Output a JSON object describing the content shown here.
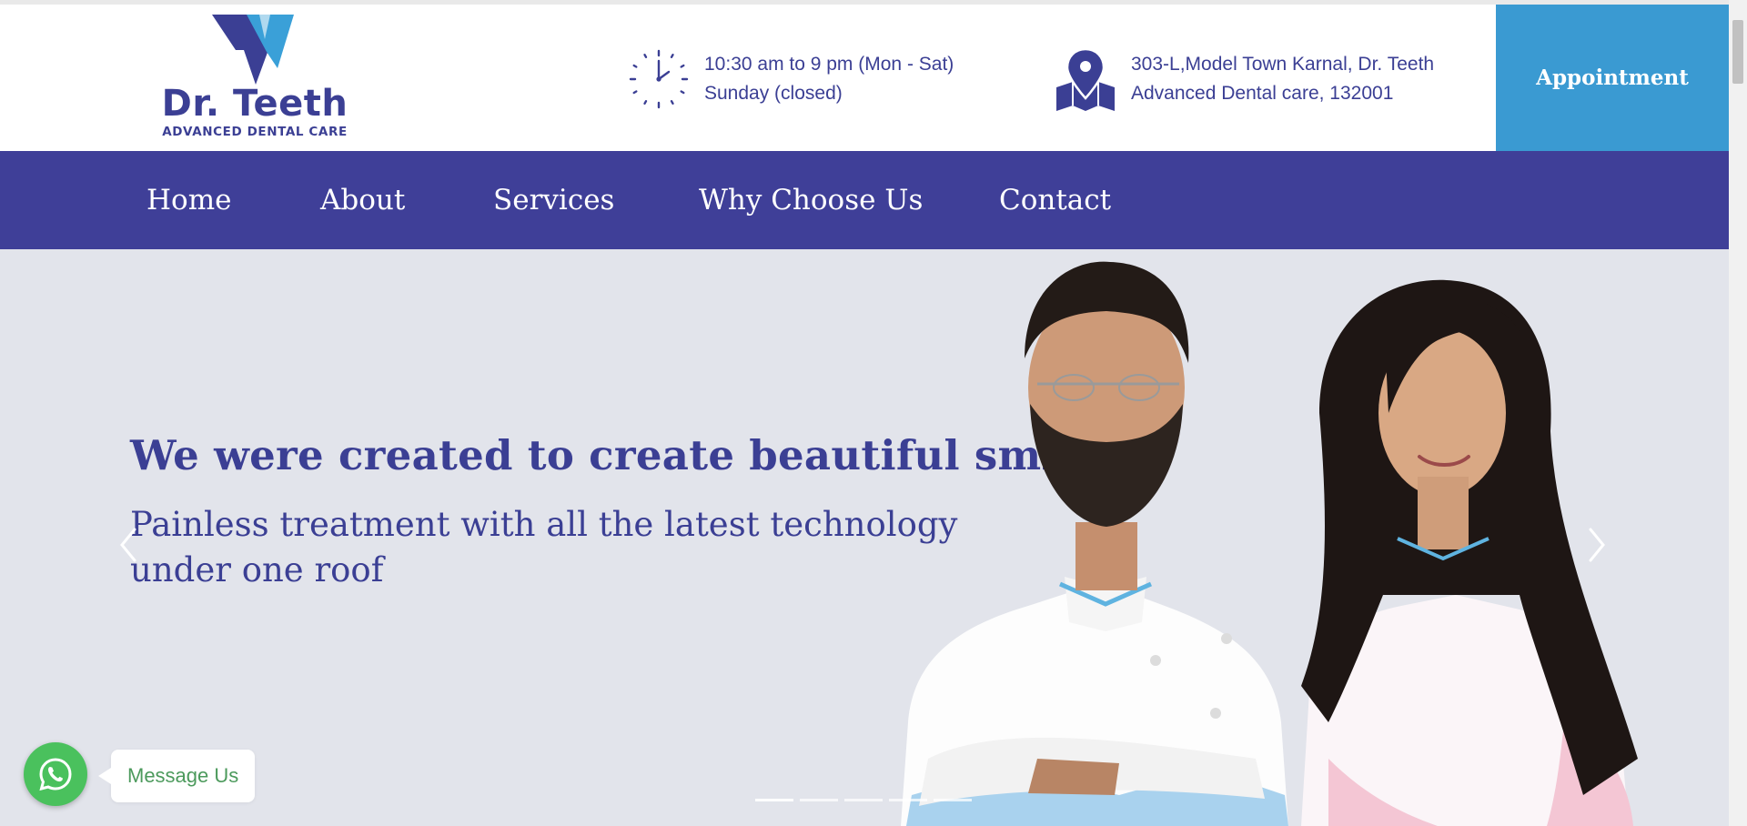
{
  "brand": {
    "name": "Dr. Teeth",
    "tagline": "ADVANCED DENTAL CARE"
  },
  "header": {
    "hours_line1": "10:30 am to 9 pm (Mon - Sat)",
    "hours_line2": "Sunday (closed)",
    "address_line1": "303-L,Model Town Karnal, Dr. Teeth",
    "address_line2": "Advanced Dental care, 132001",
    "appointment_label": "Appointment"
  },
  "nav": {
    "items": [
      {
        "label": "Home"
      },
      {
        "label": "About"
      },
      {
        "label": "Services"
      },
      {
        "label": "Why Choose Us"
      },
      {
        "label": "Contact"
      }
    ]
  },
  "hero": {
    "title": "We were created to create beautiful smiles",
    "subtitle": "Painless treatment with all the latest technology under one roof",
    "slides_total": 5,
    "active_slide": 1
  },
  "whatsapp": {
    "label": "Message Us"
  },
  "icons": [
    "tooth-logo-icon",
    "clock-icon",
    "map-pin-icon",
    "chevron-left-icon",
    "chevron-right-icon",
    "whatsapp-icon"
  ],
  "colors": {
    "brand": "#3b3f94",
    "nav_background": "#3f3f98",
    "appointment_button": "#3a9ad2",
    "hero_background": "#e2e4eb",
    "whatsapp": "#4ac15d"
  }
}
